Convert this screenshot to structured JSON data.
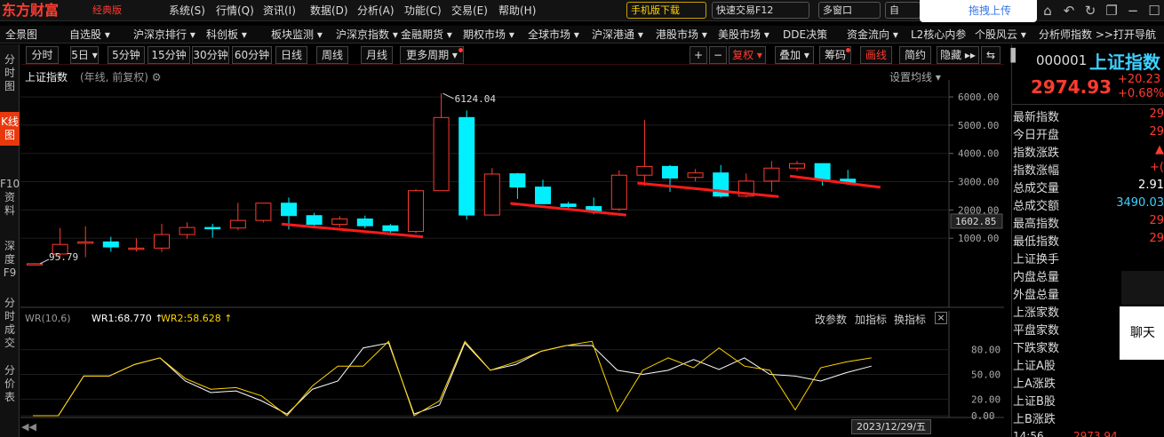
{
  "brand": {
    "name": "东方财富",
    "badge": "经典版"
  },
  "menu": [
    "系统(S)",
    "行情(Q)",
    "资讯(I)",
    "数据(D)",
    "分析(A)",
    "功能(C)",
    "交易(E)",
    "帮助(H)"
  ],
  "top_buttons": {
    "mobile": "手机版下载",
    "quick_trade": "快速交易F12",
    "multi_window": "多窗口",
    "self": "自"
  },
  "upload_label": "拖拽上传",
  "nav2": [
    "全景图",
    "自选股 ▾",
    "沪深京排行 ▾",
    "科创板 ▾",
    "板块监测 ▾",
    "沪深京指数 ▾",
    "金融期货 ▾",
    "期权市场 ▾",
    "全球市场 ▾",
    "沪深港通 ▾",
    "港股市场 ▾",
    "美股市场 ▾",
    "DDE决策",
    "资金流向 ▾",
    "L2核心内参",
    "个股风云 ▾",
    "分析师指数 >>",
    "打开导航"
  ],
  "side_tabs": [
    "分时图",
    "K线图",
    "F10资料",
    "深度F9",
    "分时成交",
    "分价表"
  ],
  "period_buttons": [
    "分时",
    "5日 ▾",
    "5分钟",
    "15分钟",
    "30分钟",
    "60分钟",
    "日线",
    "周线",
    "月线",
    "更多周期 ▾"
  ],
  "tool_buttons": {
    "plus": "+",
    "minus": "−",
    "restore": "复权 ▾",
    "overlay": "叠加 ▾",
    "chips": "筹码",
    "draw": "画线",
    "simple": "简约",
    "hide": "隐藏 ▸▸",
    "toggle": "⇆"
  },
  "chart_header": {
    "title": "上证指数",
    "subtitle": "(年线, 前复权) ⚙",
    "ma_setting": "设置均线 ▾"
  },
  "indicator": {
    "name": "WR(10,6)",
    "wr1": "WR1:68.770 ↑",
    "wr2": "WR2:58.628 ↑",
    "change_params": "改参数",
    "add": "加指标",
    "switch": "换指标"
  },
  "date_label": "2023/12/29/五",
  "quote": {
    "code": "000001",
    "name": "上证指数",
    "price": "2974.93",
    "change": "+20.23",
    "pct": "+0.68%"
  },
  "stats": [
    {
      "k": "最新指数",
      "v": "29"
    },
    {
      "k": "今日开盘",
      "v": "29"
    },
    {
      "k": "指数涨跌",
      "v": "▲"
    },
    {
      "k": "指数涨幅",
      "v": "+("
    },
    {
      "k": "总成交量",
      "v": "2.91"
    },
    {
      "k": "总成交额",
      "v": "3490.03"
    },
    {
      "k": "最高指数",
      "v": "29"
    },
    {
      "k": "最低指数",
      "v": "29"
    },
    {
      "k": "上证换手",
      "v": ""
    },
    {
      "k": "内盘总量",
      "v": ""
    },
    {
      "k": "外盘总量",
      "v": ""
    },
    {
      "k": "上涨家数",
      "v": ""
    },
    {
      "k": "平盘家数",
      "v": ""
    },
    {
      "k": "下跌家数",
      "v": ""
    },
    {
      "k": "上证A股",
      "v": ""
    },
    {
      "k": "上A涨跌",
      "v": ""
    },
    {
      "k": "上证B股",
      "v": ""
    },
    {
      "k": "上B涨跌",
      "v": ""
    }
  ],
  "chat_label": "聊天",
  "bottom_time": "14:56",
  "bottom_price": "2973.94",
  "chart_data": {
    "type": "candlestick",
    "title": "上证指数",
    "y_ticks": [
      1000,
      2000,
      3000,
      4000,
      5000,
      6000
    ],
    "ylim": [
      0,
      6600
    ],
    "current_label": "1602.85",
    "annotations": [
      {
        "text": "6124.04"
      },
      {
        "text": "95.79"
      }
    ],
    "candles": [
      {
        "o": 96,
        "c": 100,
        "h": 112,
        "l": 95
      },
      {
        "o": 440,
        "c": 780,
        "h": 1360,
        "l": 290
      },
      {
        "o": 820,
        "c": 870,
        "h": 1420,
        "l": 330
      },
      {
        "o": 870,
        "c": 690,
        "h": 1050,
        "l": 525
      },
      {
        "o": 640,
        "c": 650,
        "h": 1000,
        "l": 530
      },
      {
        "o": 650,
        "c": 1130,
        "h": 1510,
        "l": 510
      },
      {
        "o": 1130,
        "c": 1380,
        "h": 1560,
        "l": 980
      },
      {
        "o": 1380,
        "c": 1340,
        "h": 1510,
        "l": 1020
      },
      {
        "o": 1360,
        "c": 1630,
        "h": 2250,
        "l": 1280
      },
      {
        "o": 1630,
        "c": 2240,
        "h": 2250,
        "l": 1560
      },
      {
        "o": 2240,
        "c": 1800,
        "h": 2440,
        "l": 1310
      },
      {
        "o": 1800,
        "c": 1490,
        "h": 1900,
        "l": 1350
      },
      {
        "o": 1490,
        "c": 1680,
        "h": 1780,
        "l": 1390
      },
      {
        "o": 1680,
        "c": 1440,
        "h": 1800,
        "l": 1350
      },
      {
        "o": 1440,
        "c": 1260,
        "h": 1500,
        "l": 1170
      },
      {
        "o": 1240,
        "c": 2680,
        "h": 2730,
        "l": 1170
      },
      {
        "o": 2680,
        "c": 5270,
        "h": 6124,
        "l": 2670
      },
      {
        "o": 5270,
        "c": 1820,
        "h": 5520,
        "l": 1660
      },
      {
        "o": 1820,
        "c": 3270,
        "h": 3480,
        "l": 1800
      },
      {
        "o": 3280,
        "c": 2810,
        "h": 3310,
        "l": 2390
      },
      {
        "o": 2810,
        "c": 2220,
        "h": 3070,
        "l": 2210
      },
      {
        "o": 2210,
        "c": 2120,
        "h": 2290,
        "l": 1990
      },
      {
        "o": 2120,
        "c": 1940,
        "h": 2440,
        "l": 1850
      },
      {
        "o": 2030,
        "c": 3230,
        "h": 3400,
        "l": 1960
      },
      {
        "o": 3230,
        "c": 3540,
        "h": 5180,
        "l": 2850
      },
      {
        "o": 3540,
        "c": 3130,
        "h": 3590,
        "l": 2640
      },
      {
        "o": 3150,
        "c": 3310,
        "h": 3450,
        "l": 3010
      },
      {
        "o": 3310,
        "c": 2490,
        "h": 3590,
        "l": 2440
      },
      {
        "o": 2490,
        "c": 3020,
        "h": 3290,
        "l": 2440
      },
      {
        "o": 3020,
        "c": 3480,
        "h": 3730,
        "l": 2650
      },
      {
        "o": 3480,
        "c": 3640,
        "h": 3730,
        "l": 3380
      },
      {
        "o": 3640,
        "c": 3090,
        "h": 3650,
        "l": 2860
      },
      {
        "o": 3090,
        "c": 2975,
        "h": 3420,
        "l": 2885
      }
    ],
    "trendlines": [
      {
        "x1": 10,
        "y1": 1500,
        "x2": 15,
        "y2": 1050
      },
      {
        "x1": 19,
        "y1": 2230,
        "x2": 23,
        "y2": 1820
      },
      {
        "x1": 24,
        "y1": 2950,
        "x2": 29,
        "y2": 2470
      },
      {
        "x1": 30,
        "y1": 3200,
        "x2": 33,
        "y2": 2800
      }
    ],
    "wr": {
      "y_ticks": [
        0,
        20,
        50,
        80
      ],
      "wr1": [
        0,
        0,
        48,
        48,
        62,
        70,
        42,
        28,
        30,
        18,
        2,
        32,
        42,
        82,
        88,
        2,
        13,
        88,
        55,
        62,
        78,
        85,
        85,
        55,
        50,
        55,
        68,
        56,
        70,
        50,
        48,
        42,
        52,
        60
      ],
      "wr2": [
        0,
        0,
        48,
        48,
        62,
        70,
        45,
        32,
        34,
        24,
        0,
        36,
        60,
        60,
        90,
        0,
        18,
        90,
        55,
        65,
        78,
        85,
        90,
        5,
        55,
        70,
        58,
        82,
        60,
        55,
        7,
        58,
        65,
        70
      ]
    }
  }
}
